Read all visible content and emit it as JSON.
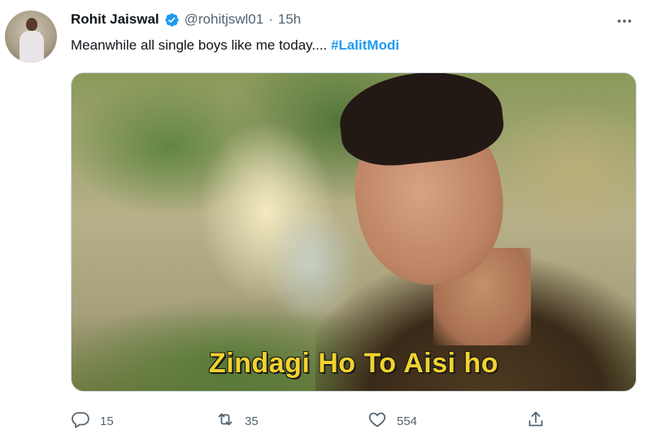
{
  "author": {
    "name": "Rohit Jaiswal",
    "handle": "@rohitjswl01",
    "separator": "·",
    "time": "15h"
  },
  "tweet": {
    "text": "Meanwhile all single boys like me today.... ",
    "hashtag": "#LalitModi"
  },
  "media": {
    "caption": "Zindagi Ho To Aisi ho"
  },
  "actions": {
    "replies": "15",
    "retweets": "35",
    "likes": "554"
  },
  "icons": {
    "verified": "verified-badge-icon",
    "more": "more-dots-icon",
    "reply": "reply-icon",
    "retweet": "retweet-icon",
    "like": "heart-icon",
    "share": "share-icon"
  },
  "colors": {
    "accent": "#1d9bf0",
    "text": "#0f1419",
    "secondary": "#536471",
    "caption": "#f2d22e"
  }
}
